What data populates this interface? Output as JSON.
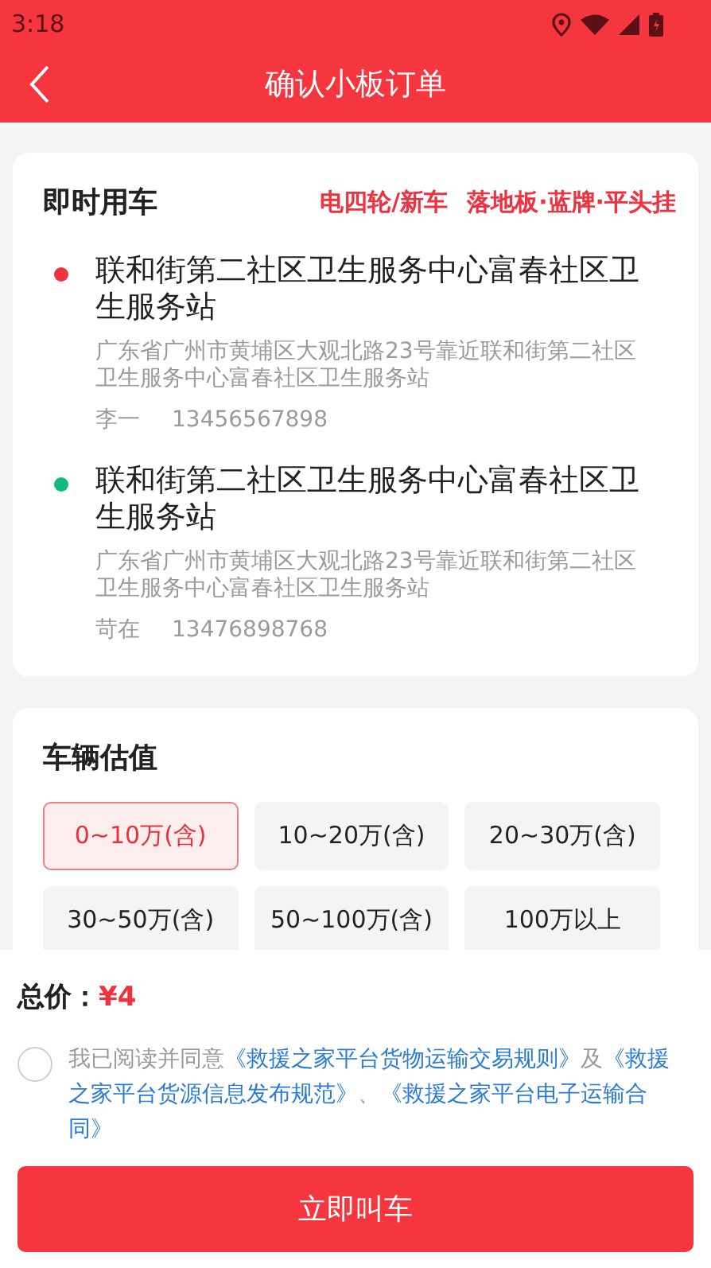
{
  "status_bar": {
    "time": "3:18"
  },
  "header": {
    "title": "确认小板订单"
  },
  "order": {
    "title": "即时用车",
    "tags": [
      "电四轮/新车",
      "落地板·蓝牌·平头挂"
    ],
    "stops": [
      {
        "color": "#ee3340",
        "name": "联和街第二社区卫生服务中心富春社区卫生服务站",
        "address": "广东省广州市黄埔区大观北路23号靠近联和街第二社区卫生服务中心富春社区卫生服务站",
        "contact": "李一",
        "phone": "13456567898"
      },
      {
        "color": "#13b97e",
        "name": "联和街第二社区卫生服务中心富春社区卫生服务站",
        "address": "广东省广州市黄埔区大观北路23号靠近联和街第二社区卫生服务中心富春社区卫生服务站",
        "contact": "苛在",
        "phone": "13476898768"
      }
    ]
  },
  "valuation": {
    "title": "车辆估值",
    "options": [
      {
        "label": "0~10万(含)",
        "selected": true
      },
      {
        "label": "10~20万(含)",
        "selected": false
      },
      {
        "label": "20~30万(含)",
        "selected": false
      },
      {
        "label": "30~50万(含)",
        "selected": false
      },
      {
        "label": "50~100万(含)",
        "selected": false
      },
      {
        "label": "100万以上",
        "selected": false
      }
    ]
  },
  "total": {
    "label": "总价：",
    "price": "¥4"
  },
  "agreement": {
    "checked": false,
    "segments": [
      {
        "kind": "text",
        "text": "我已阅读并同意"
      },
      {
        "kind": "link",
        "text": "《救援之家平台货物运输交易规则》"
      },
      {
        "kind": "text",
        "text": "及"
      },
      {
        "kind": "link",
        "text": "《救援之家平台货源信息发布规范》"
      },
      {
        "kind": "text",
        "text": "、"
      },
      {
        "kind": "link",
        "text": "《救援之家平台电子运输合同》"
      }
    ]
  },
  "submit": "立即叫车"
}
